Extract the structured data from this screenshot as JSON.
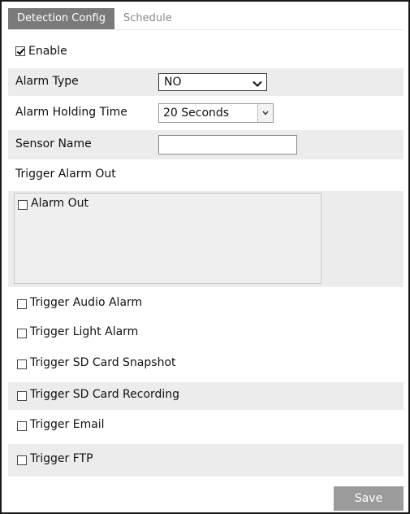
{
  "tabs": [
    {
      "label": "Detection Config",
      "active": true
    },
    {
      "label": "Schedule",
      "active": false
    }
  ],
  "enable": {
    "label": "Enable",
    "checked": true
  },
  "alarm_type": {
    "label": "Alarm Type",
    "value": "NO"
  },
  "alarm_holding_time": {
    "label": "Alarm Holding Time",
    "value": "20 Seconds"
  },
  "sensor_name": {
    "label": "Sensor Name",
    "value": ""
  },
  "trigger_alarm_out": {
    "label": "Trigger Alarm Out",
    "items": [
      {
        "label": "Alarm Out",
        "checked": false
      }
    ]
  },
  "triggers": [
    {
      "label": "Trigger Audio Alarm",
      "checked": false
    },
    {
      "label": "Trigger Light Alarm",
      "checked": false
    },
    {
      "label": "Trigger SD Card Snapshot",
      "checked": false
    },
    {
      "label": "Trigger SD Card Recording",
      "checked": false
    },
    {
      "label": "Trigger Email",
      "checked": false
    },
    {
      "label": "Trigger FTP",
      "checked": false
    }
  ],
  "save_label": "Save",
  "colors": {
    "active_tab_bg": "#7a7a7a",
    "inactive_tab_text": "#8a8a8a",
    "row_shade": "#ececec",
    "save_button_bg": "#9b9b9b"
  }
}
